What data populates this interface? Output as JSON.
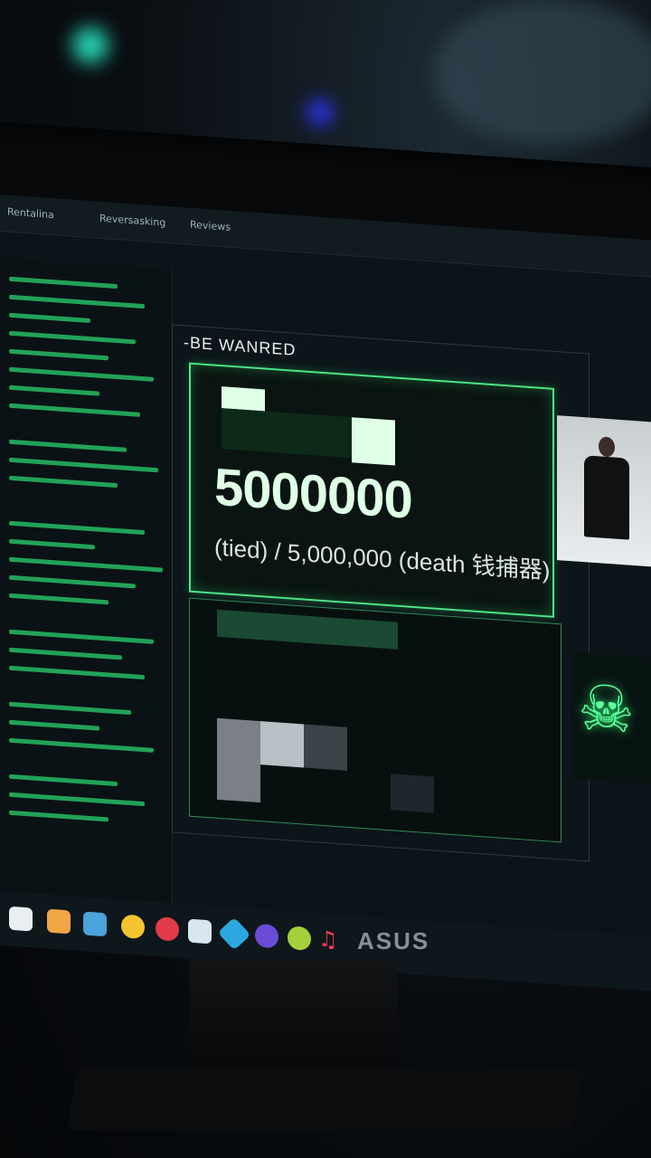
{
  "app": {
    "tabs": [
      "Rentalina",
      "Reversasking",
      "Reviews"
    ],
    "panel_title": "-BE WANRED"
  },
  "bounty": {
    "amount": "5000000",
    "subtitle": "(tied) / 5,000,000 (death 钱捕器)"
  },
  "brand": {
    "monitor_logo": "ASUS"
  },
  "colors": {
    "accent": "#4ee486",
    "background": "#0b1418",
    "text": "#dfffe6"
  },
  "icons": [
    "home-icon",
    "folder-icon",
    "app-icon",
    "browser-icon",
    "red-app-icon",
    "window-icon",
    "diamond-icon",
    "gem-icon",
    "circle-icon",
    "music-icon"
  ]
}
